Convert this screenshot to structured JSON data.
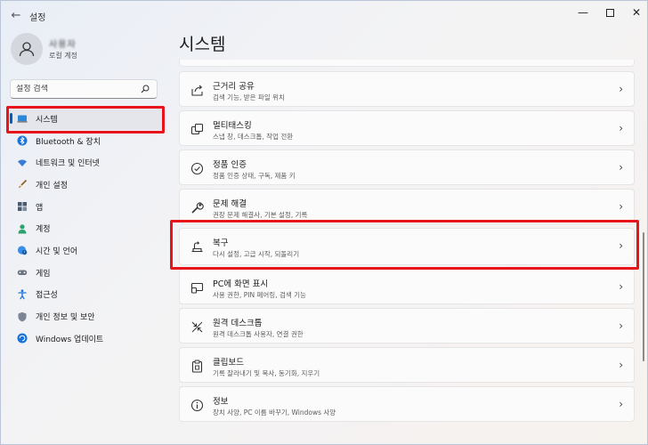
{
  "app": {
    "title": "설정"
  },
  "user": {
    "name": "사용자",
    "account_type": "로컬 계정"
  },
  "search": {
    "placeholder": "설정 검색"
  },
  "sidebar": {
    "items": [
      {
        "label": "시스템",
        "icon": "laptop-icon",
        "selected": true
      },
      {
        "label": "Bluetooth & 장치",
        "icon": "bluetooth-icon"
      },
      {
        "label": "네트워크 및 인터넷",
        "icon": "wifi-icon"
      },
      {
        "label": "개인 설정",
        "icon": "brush-icon"
      },
      {
        "label": "앱",
        "icon": "apps-icon"
      },
      {
        "label": "계정",
        "icon": "person-icon"
      },
      {
        "label": "시간 및 언어",
        "icon": "globe-clock-icon"
      },
      {
        "label": "게임",
        "icon": "gamepad-icon"
      },
      {
        "label": "접근성",
        "icon": "accessibility-icon"
      },
      {
        "label": "개인 정보 및 보안",
        "icon": "shield-icon"
      },
      {
        "label": "Windows 업데이트",
        "icon": "update-icon"
      }
    ]
  },
  "main": {
    "title": "시스템",
    "cards": [
      {
        "title": "근거리 공유",
        "subtitle": "검색 기능, 받은 파일 위치",
        "icon": "share-icon"
      },
      {
        "title": "멀티태스킹",
        "subtitle": "스냅 창, 데스크톱, 작업 전환",
        "icon": "multitasking-icon"
      },
      {
        "title": "정품 인증",
        "subtitle": "정품 인증 상태, 구독, 제품 키",
        "icon": "activation-icon"
      },
      {
        "title": "문제 해결",
        "subtitle": "권장 문제 해결사, 기본 설정, 기록",
        "icon": "wrench-icon"
      },
      {
        "title": "복구",
        "subtitle": "다시 설정, 고급 시작, 되돌리기",
        "icon": "recovery-icon"
      },
      {
        "title": "PC에 화면 표시",
        "subtitle": "사용 권한, PIN 페어링, 검색 기능",
        "icon": "project-icon"
      },
      {
        "title": "원격 데스크톱",
        "subtitle": "원격 데스크톱 사용자, 연결 권한",
        "icon": "remote-desktop-icon"
      },
      {
        "title": "클립보드",
        "subtitle": "기록 잘라내기 및 복사, 동기화, 지우기",
        "icon": "clipboard-icon"
      },
      {
        "title": "정보",
        "subtitle": "장치 사양, PC 이름 바꾸기, Windows 사양",
        "icon": "info-icon"
      }
    ]
  },
  "colors": {
    "accent": "#005fb8",
    "highlight": "#e8141c"
  }
}
